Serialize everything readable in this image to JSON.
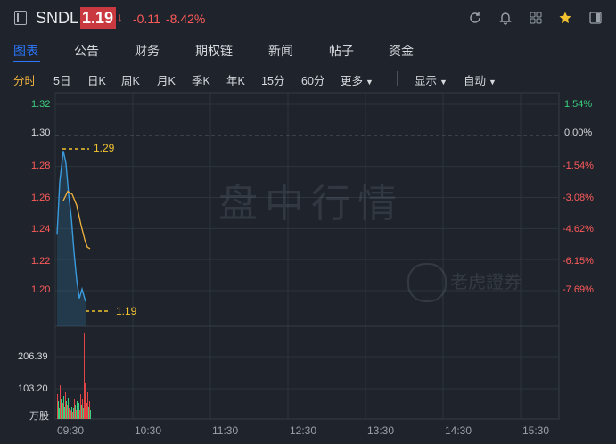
{
  "header": {
    "symbol": "SNDL",
    "price": "1.19",
    "change": "-0.11",
    "change_pct": "-8.42%"
  },
  "tabs": [
    {
      "label": "图表"
    },
    {
      "label": "公告"
    },
    {
      "label": "财务"
    },
    {
      "label": "期权链"
    },
    {
      "label": "新闻"
    },
    {
      "label": "帖子"
    },
    {
      "label": "资金"
    }
  ],
  "toolbar": {
    "periods": [
      "分时",
      "5日",
      "日K",
      "周K",
      "月K",
      "季K",
      "年K",
      "15分",
      "60分"
    ],
    "more": "更多",
    "display": "显示",
    "auto": "自动"
  },
  "chart": {
    "watermark": "盘中行情",
    "brand": "老虎證券",
    "y_labels": [
      "1.32",
      "1.30",
      "1.28",
      "1.26",
      "1.24",
      "1.22",
      "1.20"
    ],
    "pct_labels": [
      "1.54%",
      "0.00%",
      "-1.54%",
      "-3.08%",
      "-4.62%",
      "-6.15%",
      "-7.69%"
    ],
    "vol_labels": [
      "206.39",
      "103.20",
      "万股"
    ],
    "time_labels": [
      "09:30",
      "10:30",
      "11:30",
      "12:30",
      "13:30",
      "14:30",
      "15:30"
    ],
    "hi_label": "1.29",
    "lo_label": "1.19"
  },
  "chart_data": {
    "type": "line",
    "title": "",
    "xlabel": "",
    "ylabel": "",
    "ylim": [
      1.19,
      1.32
    ],
    "y_ticks": [
      1.32,
      1.3,
      1.28,
      1.26,
      1.24,
      1.22,
      1.2
    ],
    "x_ticks": [
      "09:30",
      "10:30",
      "11:30",
      "12:30",
      "13:30",
      "14:30",
      "15:30"
    ],
    "series": [
      {
        "values": [
          1.236,
          1.27,
          1.29,
          1.282,
          1.262,
          1.247,
          1.225,
          1.207,
          1.195,
          1.201,
          1.193
        ]
      },
      {
        "values": [
          null,
          null,
          1.258,
          1.264,
          1.262,
          1.255,
          1.242,
          1.233,
          1.228,
          1.227
        ]
      }
    ],
    "volume": {
      "ticks": [
        206.39,
        103.2
      ],
      "unit": "万股"
    }
  },
  "colors": {
    "accent": "#2b78ff",
    "up": "#3ccf7f",
    "down": "#ff5a5a",
    "neutral": "#d6d9de",
    "price_line": "#3a9bdc",
    "avg_line": "#f2b33d"
  }
}
